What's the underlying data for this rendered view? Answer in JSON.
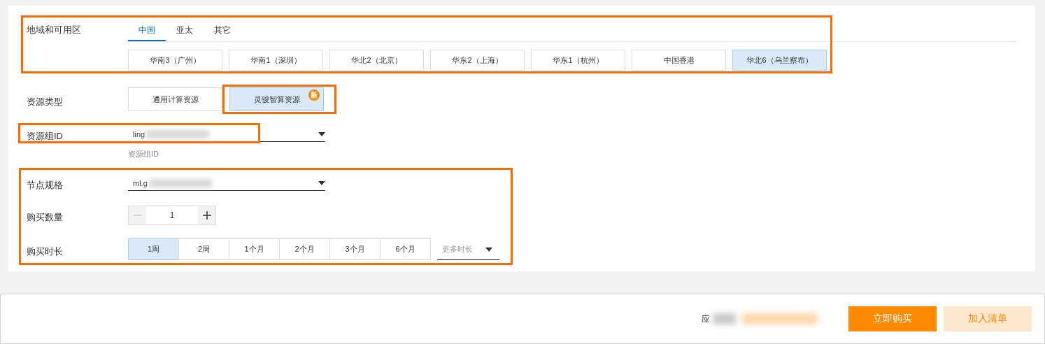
{
  "region": {
    "label": "地域和可用区",
    "tabs": [
      {
        "label": "中国",
        "selected": true
      },
      {
        "label": "亚太",
        "selected": false
      },
      {
        "label": "其它",
        "selected": false
      }
    ],
    "zones": [
      {
        "label": "华南3（广州）",
        "selected": false
      },
      {
        "label": "华南1（深圳）",
        "selected": false
      },
      {
        "label": "华北2（北京）",
        "selected": false
      },
      {
        "label": "华东2（上海）",
        "selected": false
      },
      {
        "label": "华东1（杭州）",
        "selected": false
      },
      {
        "label": "中国香港",
        "selected": false
      },
      {
        "label": "华北6（乌兰察布）",
        "selected": true
      }
    ]
  },
  "resource_type": {
    "label": "资源类型",
    "options": [
      {
        "label": "通用计算资源",
        "selected": false
      },
      {
        "label": "灵骏智算资源",
        "selected": true,
        "badge": "新"
      }
    ]
  },
  "resource_group": {
    "label": "资源组ID",
    "value": "ling",
    "hint": "资源组ID"
  },
  "node_spec": {
    "label": "节点规格",
    "value": "ml.g"
  },
  "quantity": {
    "label": "购买数量",
    "value": "1",
    "minus_disabled": true
  },
  "duration": {
    "label": "购买时长",
    "options": [
      {
        "label": "1周",
        "selected": true
      },
      {
        "label": "2周",
        "selected": false
      },
      {
        "label": "1个月",
        "selected": false
      },
      {
        "label": "2个月",
        "selected": false
      },
      {
        "label": "3个月",
        "selected": false
      },
      {
        "label": "6个月",
        "selected": false
      }
    ],
    "more": {
      "placeholder": "更多时长"
    }
  },
  "footer": {
    "price_label": "应",
    "buttons": [
      {
        "label": "立即购买",
        "kind": "primary"
      },
      {
        "label": "加入清单",
        "kind": "secondary"
      }
    ]
  }
}
